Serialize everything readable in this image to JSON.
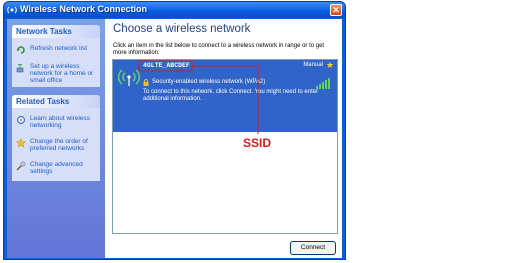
{
  "window": {
    "title": "Wireless Network Connection",
    "close_glyph": "✕"
  },
  "sidebar": {
    "network_tasks": {
      "heading": "Network Tasks",
      "items": [
        {
          "label": "Refresh network list",
          "icon": "refresh-icon"
        },
        {
          "label": "Set up a wireless network for a home or small office",
          "icon": "setup-network-icon"
        }
      ]
    },
    "related_tasks": {
      "heading": "Related Tasks",
      "items": [
        {
          "label": "Learn about wireless networking",
          "icon": "learn-icon"
        },
        {
          "label": "Change the order of preferred networks",
          "icon": "star-icon"
        },
        {
          "label": "Change advanced settings",
          "icon": "advanced-settings-icon"
        }
      ]
    }
  },
  "main": {
    "heading": "Choose a wireless network",
    "instructions": "Click an item in the list below to connect to a wireless network in range or to get more information.",
    "networks": [
      {
        "ssid": "4GLTE_ABCDEF",
        "mode": "Manual",
        "security": "Security-enabled wireless network (WPA2)",
        "description": "To connect to this network, click Connect. You might need to enter additional information."
      }
    ],
    "connect_label": "Connect"
  },
  "annotation": {
    "label": "SSID",
    "color": "#d81b1b"
  },
  "colors": {
    "title_bar": "#0a5ce0",
    "selected_item": "#3164c8",
    "heading": "#1f3f8f",
    "link": "#215dc6"
  }
}
